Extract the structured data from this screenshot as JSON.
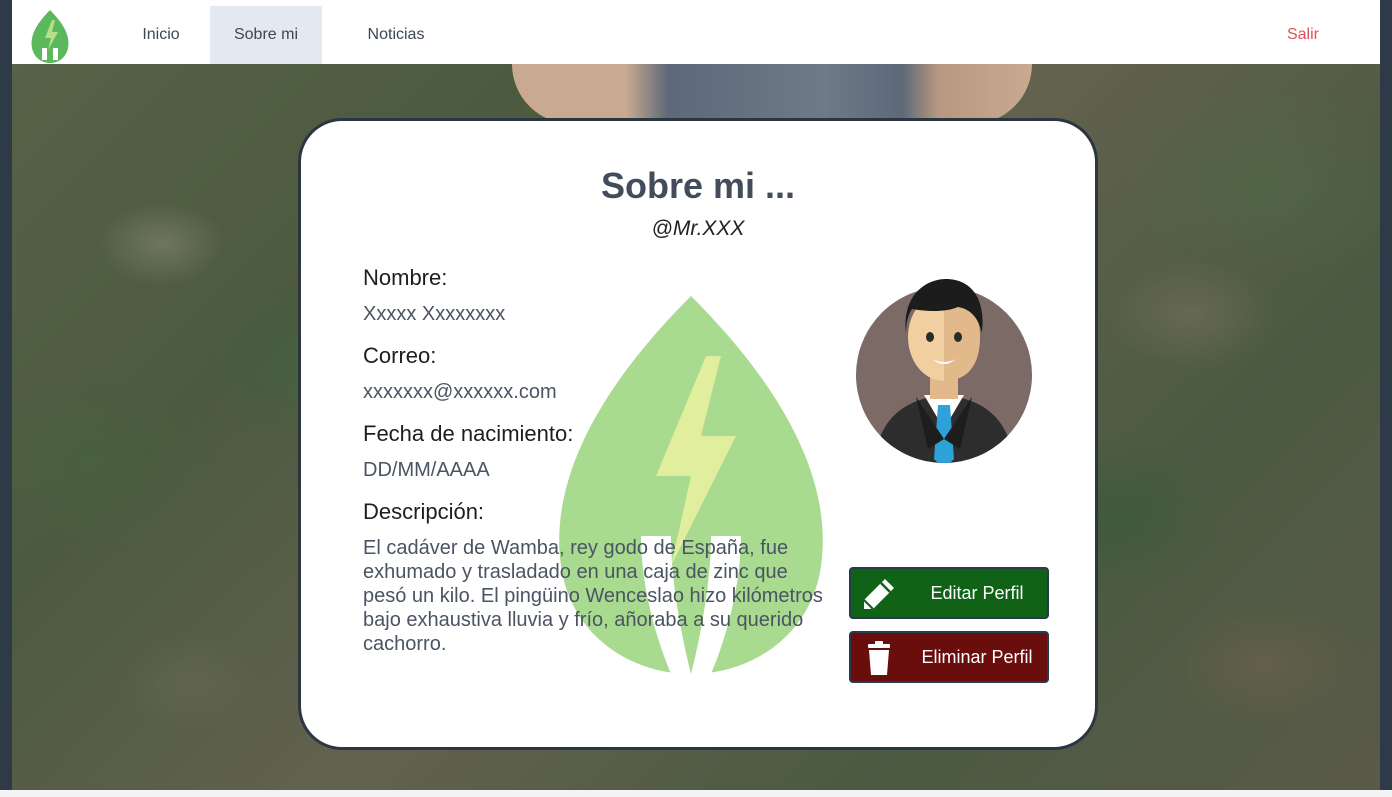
{
  "nav": {
    "home": "Inicio",
    "about": "Sobre mi",
    "news": "Noticias",
    "logout": "Salir",
    "logo_icon": "leaf-plug-logo-icon"
  },
  "profile": {
    "title": "Sobre mi ...",
    "handle": "@Mr.XXX",
    "name_label": "Nombre:",
    "name_value": "Xxxxx Xxxxxxxx",
    "email_label": "Correo:",
    "email_value": "xxxxxxx@xxxxxx.com",
    "birth_label": "Fecha de nacimiento:",
    "birth_value": "DD/MM/AAAA",
    "desc_label": "Descripción:",
    "desc_value": "El cadáver de Wamba, rey godo de España, fue exhumado y trasladado en una caja de zinc que pesó un kilo. El pingüino Wenceslao hizo kilómetros bajo exhaustiva lluvia y frío, añoraba a su querido cachorro.",
    "avatar_icon": "businessman-avatar-icon"
  },
  "actions": {
    "edit_label": "Editar Perfil",
    "edit_icon": "pencil-icon",
    "delete_label": "Eliminar Perfil",
    "delete_icon": "trash-icon"
  },
  "colors": {
    "edit_button": "#106217",
    "delete_button": "#6a0d0d",
    "logout_link": "#e0525b",
    "active_tab": "#e4e8f0"
  }
}
